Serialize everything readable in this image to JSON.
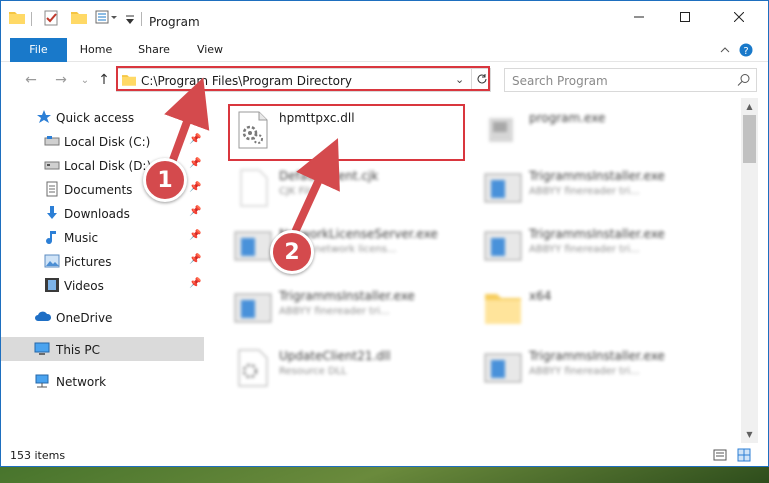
{
  "window": {
    "title": "Program",
    "controls": {
      "minimize": "minimize-icon",
      "maximize": "maximize-icon",
      "close": "close-icon"
    }
  },
  "ribbon": {
    "tabs": [
      {
        "label": "File"
      },
      {
        "label": "Home"
      },
      {
        "label": "Share"
      },
      {
        "label": "View"
      }
    ]
  },
  "address": {
    "path": "C:\\Program Files\\Program Directory",
    "search_placeholder": "Search Program"
  },
  "sidebar": {
    "items": [
      {
        "label": "Quick access",
        "icon": "star-icon"
      },
      {
        "label": "Local Disk (C:)",
        "icon": "drive-icon",
        "pinned": true
      },
      {
        "label": "Local Disk (D:)",
        "icon": "drive-icon",
        "pinned": true
      },
      {
        "label": "Documents",
        "icon": "documents-icon",
        "pinned": true
      },
      {
        "label": "Downloads",
        "icon": "download-icon",
        "pinned": true
      },
      {
        "label": "Music",
        "icon": "music-icon",
        "pinned": true
      },
      {
        "label": "Pictures",
        "icon": "pictures-icon",
        "pinned": true
      },
      {
        "label": "Videos",
        "icon": "videos-icon",
        "pinned": true
      },
      {
        "label": "OneDrive",
        "icon": "cloud-icon"
      },
      {
        "label": "This PC",
        "icon": "computer-icon",
        "selected": true
      },
      {
        "label": "Network",
        "icon": "network-icon"
      }
    ]
  },
  "files": [
    {
      "name": "hpmttpxc.dll",
      "desc": "",
      "icon": "dll-gear-icon"
    },
    {
      "name": "program.exe",
      "desc": "",
      "icon": "program-icon"
    },
    {
      "name": "DefaultClient.cjk",
      "desc": "CJK File",
      "icon": "file-icon"
    },
    {
      "name": "TrigrammsInstaller.exe",
      "desc": "ABBYY finereader tri...",
      "icon": "window-icon"
    },
    {
      "name": "NetworkLicenseServer.exe",
      "desc": "ABBYY network licens...",
      "icon": "window-icon"
    },
    {
      "name": "TrigrammsInstaller.exe",
      "desc": "ABBYY finereader tri...",
      "icon": "window-icon"
    },
    {
      "name": "TrigrammsInstaller.exe",
      "desc": "ABBYY finereader tri...",
      "icon": "window-icon"
    },
    {
      "name": "x64",
      "desc": "",
      "icon": "folder-icon"
    },
    {
      "name": "UpdateClient21.dll",
      "desc": "Resource DLL",
      "icon": "dll-gear-icon"
    },
    {
      "name": "TrigrammsInstaller.exe",
      "desc": "ABBYY finereader tri...",
      "icon": "window-icon"
    }
  ],
  "status": {
    "item_count": "153 items"
  },
  "annotations": [
    {
      "label": "1"
    },
    {
      "label": "2"
    }
  ],
  "colors": {
    "accent": "#1979ca",
    "highlight": "#d9363e",
    "badge": "#d44a4d"
  }
}
